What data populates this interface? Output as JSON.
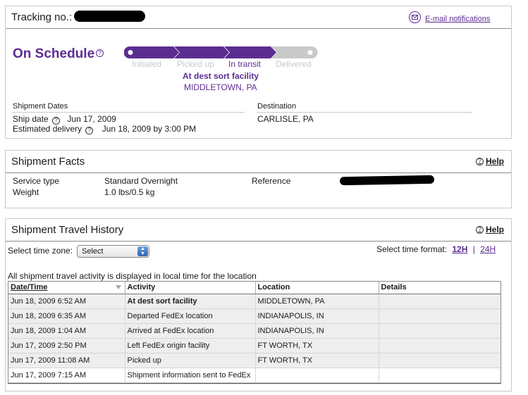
{
  "header": {
    "tracking_label": "Tracking no.:",
    "email_notifications": "E-mail notifications",
    "status": "On Schedule",
    "stages": [
      "Initiated",
      "Picked up",
      "In transit",
      "Delivered"
    ],
    "current_stage_index": 2,
    "current_status": "At dest sort facility",
    "current_location": "MIDDLETOWN, PA",
    "shipment_dates_title": "Shipment Dates",
    "ship_date_label": "Ship date",
    "ship_date": "Jun 17, 2009",
    "est_delivery_label": "Estimated delivery",
    "est_delivery": "Jun 18, 2009 by 3:00 PM",
    "destination_title": "Destination",
    "destination": "CARLISLE, PA"
  },
  "facts": {
    "title": "Shipment Facts",
    "help": "Help",
    "service_type_label": "Service type",
    "service_type": "Standard Overnight",
    "weight_label": "Weight",
    "weight": "1.0 lbs/0.5 kg",
    "reference_label": "Reference"
  },
  "history": {
    "title": "Shipment Travel History",
    "help": "Help",
    "timezone_label": "Select time zone:",
    "timezone_value": "Select",
    "time_format_label": "Select time format:",
    "format_12h": "12H",
    "format_sep": "|",
    "format_24h": "24H",
    "note": "All shipment travel activity is displayed in local time for the location",
    "columns": [
      "Date/Time",
      "Activity",
      "Location",
      "Details"
    ],
    "rows": [
      {
        "datetime": "Jun 18, 2009 6:52 AM",
        "activity": "At dest sort facility",
        "location": "MIDDLETOWN, PA",
        "details": ""
      },
      {
        "datetime": "Jun 18, 2009 6:35 AM",
        "activity": "Departed FedEx location",
        "location": "INDIANAPOLIS, IN",
        "details": ""
      },
      {
        "datetime": "Jun 18, 2009 1:04 AM",
        "activity": "Arrived at FedEx location",
        "location": "INDIANAPOLIS, IN",
        "details": ""
      },
      {
        "datetime": "Jun 17, 2009 2:50 PM",
        "activity": "Left FedEx origin facility",
        "location": "FT WORTH, TX",
        "details": ""
      },
      {
        "datetime": "Jun 17, 2009 11:08 AM",
        "activity": "Picked up",
        "location": "FT WORTH, TX",
        "details": ""
      },
      {
        "datetime": "Jun 17, 2009 7:15 AM",
        "activity": "Shipment information sent to FedEx",
        "location": "",
        "details": ""
      }
    ]
  },
  "colors": {
    "brand_purple": "#5c2d91",
    "inactive_grey": "#c9c9c9"
  }
}
